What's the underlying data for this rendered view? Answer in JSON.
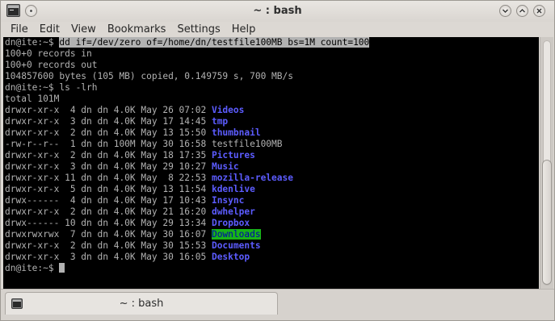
{
  "window": {
    "title": "~ : bash"
  },
  "menu": [
    "File",
    "Edit",
    "View",
    "Bookmarks",
    "Settings",
    "Help"
  ],
  "terminal": {
    "prompt1": "dn@ite:~$ ",
    "command1": "dd if=/dev/zero of=/home/dn/testfile100MB bs=1M count=100",
    "out1": "100+0 records in",
    "out2": "100+0 records out",
    "out3": "104857600 bytes (105 MB) copied, 0.149759 s, 700 MB/s",
    "prompt2": "dn@ite:~$ ",
    "command2": "ls -lrh",
    "total": "total 101M",
    "listing": [
      {
        "meta": "drwxr-xr-x  4 dn dn 4.0K May 26 07:02 ",
        "name": "Videos",
        "kind": "dir"
      },
      {
        "meta": "drwxr-xr-x  3 dn dn 4.0K May 17 14:45 ",
        "name": "tmp",
        "kind": "dir"
      },
      {
        "meta": "drwxr-xr-x  2 dn dn 4.0K May 13 15:50 ",
        "name": "thumbnail",
        "kind": "dir"
      },
      {
        "meta": "-rw-r--r--  1 dn dn 100M May 30 16:58 ",
        "name": "testfile100MB",
        "kind": "file"
      },
      {
        "meta": "drwxr-xr-x  2 dn dn 4.0K May 18 17:35 ",
        "name": "Pictures",
        "kind": "dir"
      },
      {
        "meta": "drwxr-xr-x  3 dn dn 4.0K May 29 10:27 ",
        "name": "Music",
        "kind": "dir"
      },
      {
        "meta": "drwxr-xr-x 11 dn dn 4.0K May  8 22:53 ",
        "name": "mozilla-release",
        "kind": "dir"
      },
      {
        "meta": "drwxr-xr-x  5 dn dn 4.0K May 13 11:54 ",
        "name": "kdenlive",
        "kind": "dir"
      },
      {
        "meta": "drwx------  4 dn dn 4.0K May 17 10:43 ",
        "name": "Insync",
        "kind": "dir"
      },
      {
        "meta": "drwxr-xr-x  2 dn dn 4.0K May 21 16:20 ",
        "name": "dwhelper",
        "kind": "dir"
      },
      {
        "meta": "drwx------ 10 dn dn 4.0K May 29 13:34 ",
        "name": "Dropbox",
        "kind": "dir"
      },
      {
        "meta": "drwxrwxrwx  7 dn dn 4.0K May 30 16:07 ",
        "name": "Downloads",
        "kind": "dir-ow"
      },
      {
        "meta": "drwxr-xr-x  2 dn dn 4.0K May 30 15:53 ",
        "name": "Documents",
        "kind": "dir"
      },
      {
        "meta": "drwxr-xr-x  3 dn dn 4.0K May 30 16:05 ",
        "name": "Desktop",
        "kind": "dir"
      }
    ],
    "prompt3": "dn@ite:~$ "
  },
  "tab": {
    "label": "~ : bash"
  },
  "icons": {
    "app": "terminal-icon",
    "pin": "keep-on-all-desktops-icon",
    "minimize": "chevron-down-icon",
    "maximize": "chevron-up-icon",
    "close": "close-icon"
  },
  "colors": {
    "terminal_bg": "#000000",
    "terminal_fg": "#b2b2b2",
    "directory": "#5c5cff",
    "other_writable_bg": "#18b218"
  }
}
